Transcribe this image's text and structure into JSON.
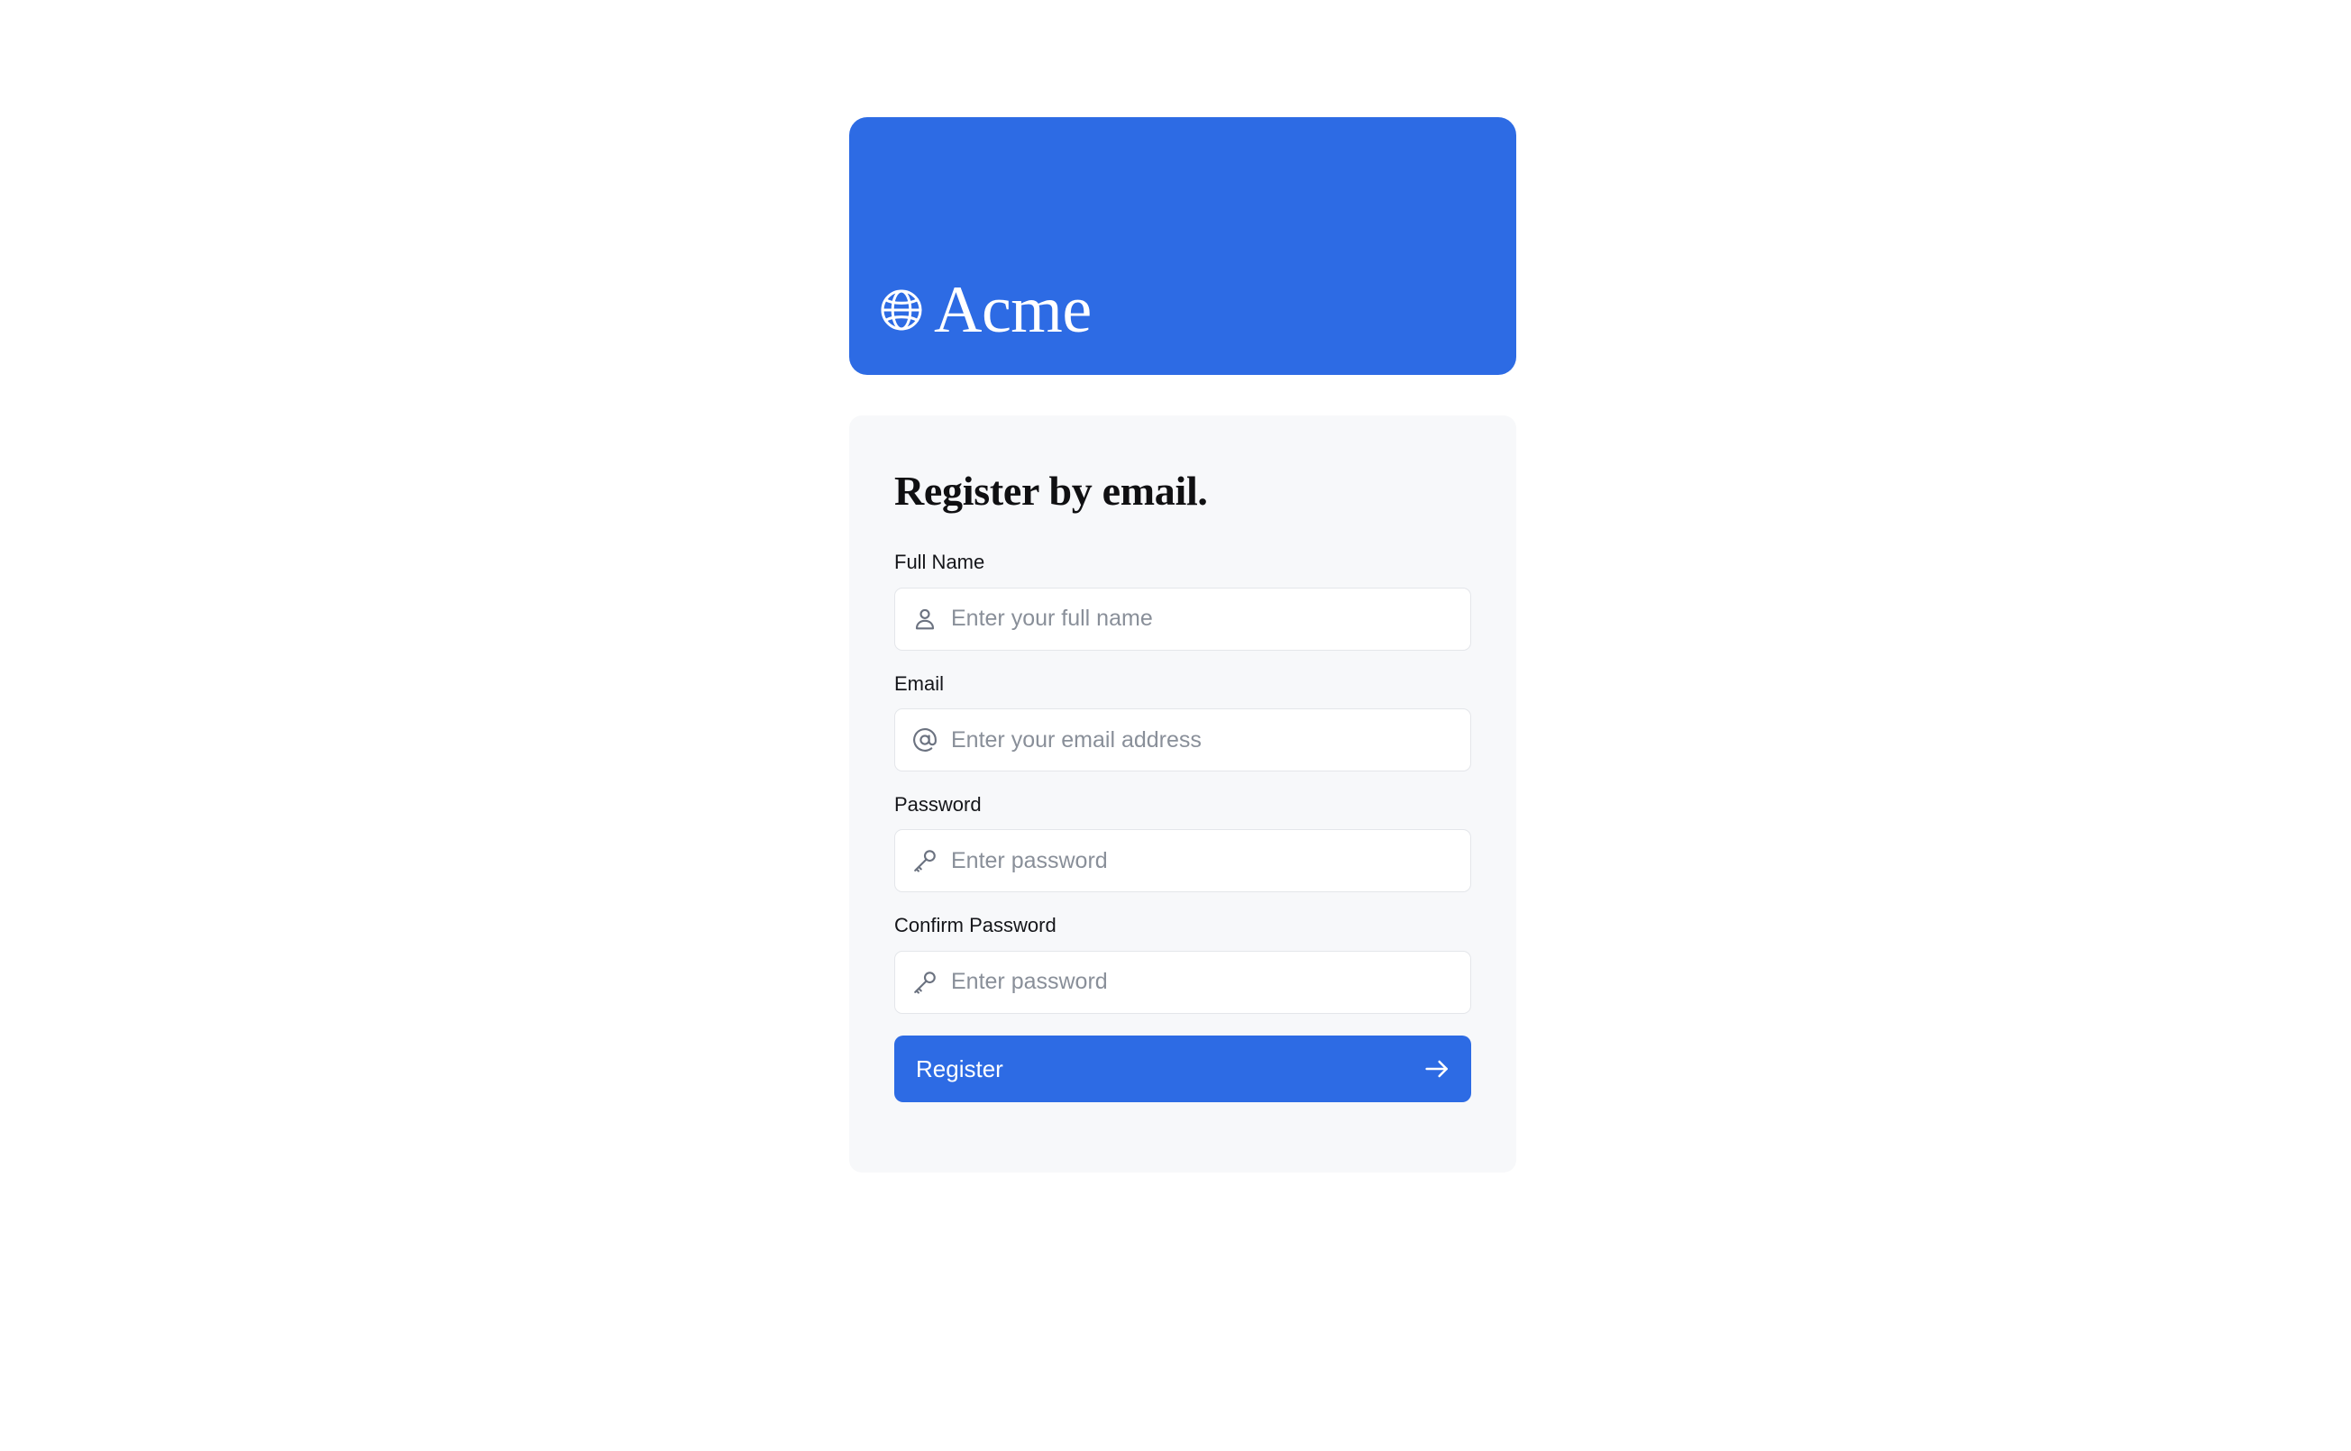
{
  "brand": {
    "name": "Acme",
    "logo_icon": "globe-icon",
    "header_color": "#2d6be4"
  },
  "form": {
    "title": "Register by email.",
    "card_background": "#f7f8fa",
    "fields": [
      {
        "label": "Full Name",
        "placeholder": "Enter your full name",
        "value": "",
        "icon": "user-icon",
        "type": "text"
      },
      {
        "label": "Email",
        "placeholder": "Enter your email address",
        "value": "",
        "icon": "at-sign-icon",
        "type": "email"
      },
      {
        "label": "Password",
        "placeholder": "Enter password",
        "value": "",
        "icon": "key-icon",
        "type": "password"
      },
      {
        "label": "Confirm Password",
        "placeholder": "Enter password",
        "value": "",
        "icon": "key-icon",
        "type": "password"
      }
    ],
    "submit": {
      "label": "Register",
      "icon": "arrow-right-icon",
      "color": "#2d6be4"
    }
  }
}
